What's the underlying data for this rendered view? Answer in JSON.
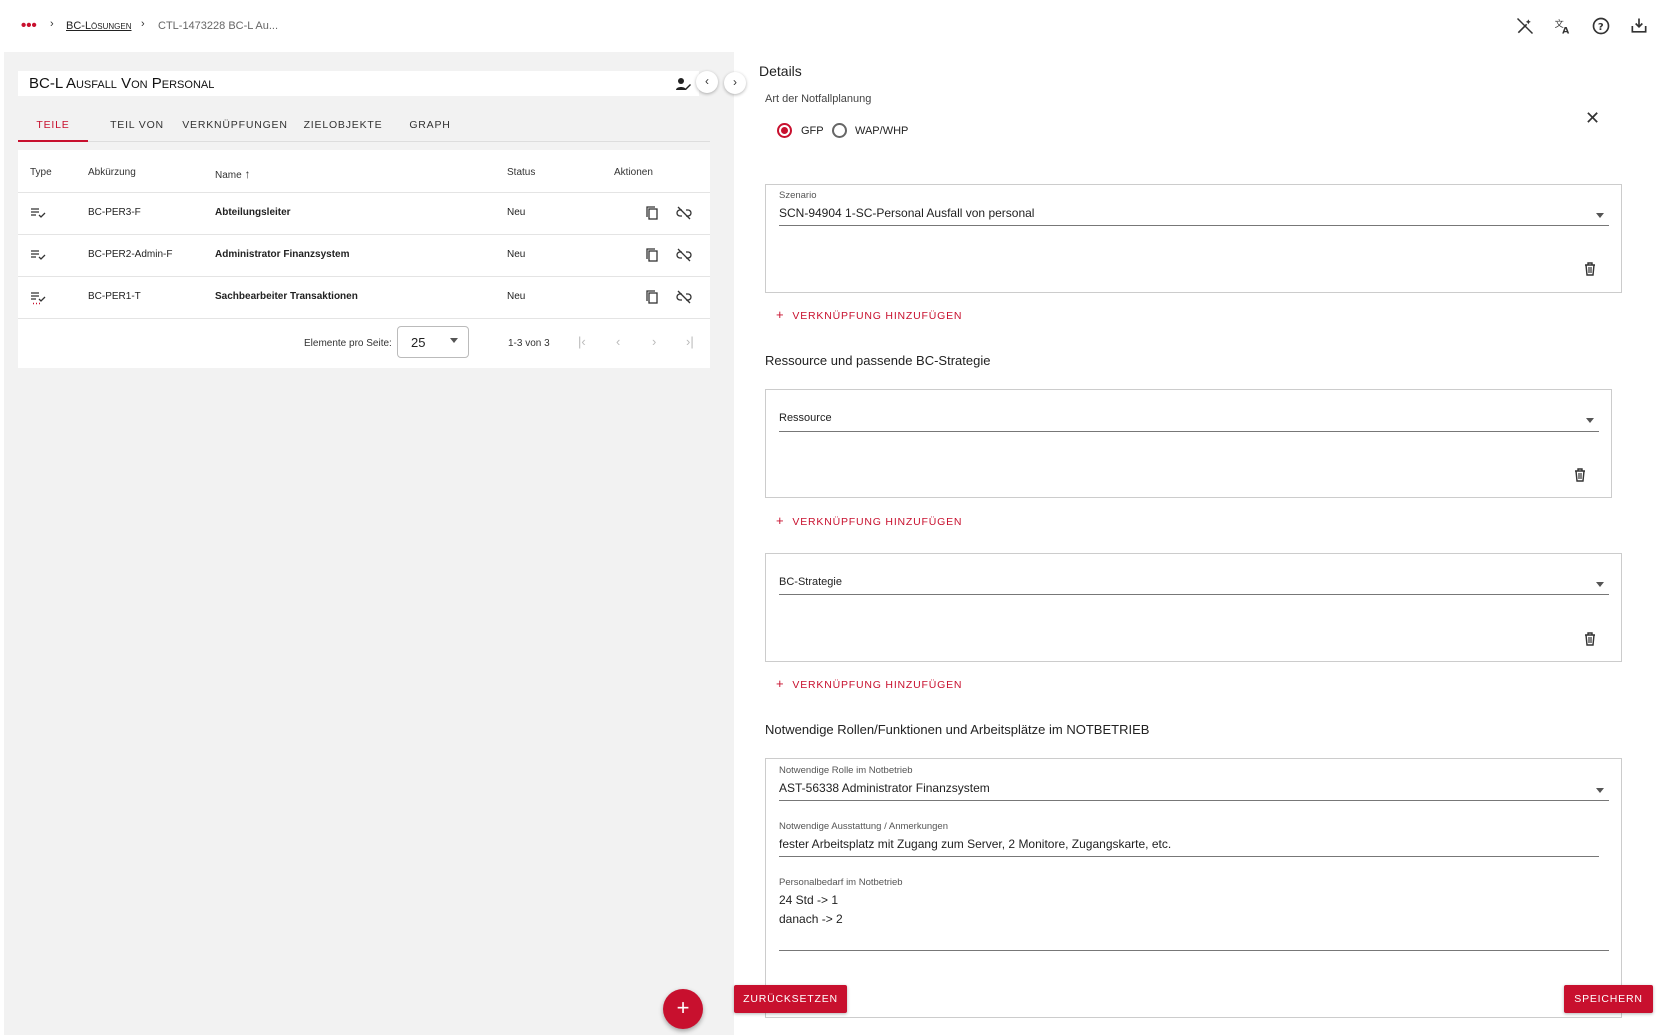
{
  "breadcrumb": {
    "menu_dots": "•••",
    "link": "BC-Lösungen",
    "current": "CTL-1473228 BC-L Au..."
  },
  "topbar_icons": [
    "magic-wand-off-icon",
    "translate-icon",
    "help-icon",
    "inbox-download-icon"
  ],
  "left": {
    "title": "BC-L Ausfall Von Personal",
    "tabs": [
      "TEILE",
      "TEIL VON",
      "VERKNÜPFUNGEN",
      "ZIELOBJEKTE",
      "GRAPH"
    ],
    "table": {
      "headers": {
        "type": "Type",
        "abk": "Abkürzung",
        "name": "Name",
        "status": "Status",
        "actions": "Aktionen"
      },
      "rows": [
        {
          "abk": "BC-PER3-F",
          "name": "Abteilungsleiter",
          "status": "Neu"
        },
        {
          "abk": "BC-PER2-Admin-F",
          "name": "Administrator Finanzsystem",
          "status": "Neu"
        },
        {
          "abk": "BC-PER1-T",
          "name": "Sachbearbeiter Transaktionen",
          "status": "Neu"
        }
      ]
    },
    "pager": {
      "label": "Elemente pro Seite:",
      "per_page": "25",
      "range": "1-3 von 3"
    },
    "fab": "+"
  },
  "right": {
    "details_title": "Details",
    "art_label": "Art der Notfallplanung",
    "radio_gfp": "GFP",
    "radio_wap": "WAP/WHP",
    "selected_radio": "GFP",
    "szenario": {
      "label": "Szenario",
      "value": "SCN-94904 1-SC-Personal Ausfall von personal"
    },
    "add_link": "VERKNÜPFUNG HINZUFÜGEN",
    "ressource_heading": "Ressource und passende BC-Strategie",
    "ressource_label": "Ressource",
    "strategie_label": "BC-Strategie",
    "rollen_heading": "Notwendige Rollen/Funktionen und Arbeitsplätze im NOTBETRIEB",
    "rolle": {
      "label": "Notwendige Rolle im Notbetrieb",
      "value": "AST-56338 Administrator Finanzsystem"
    },
    "ausstattung": {
      "label": "Notwendige Ausstattung / Anmerkungen",
      "value": "fester Arbeitsplatz mit Zugang zum Server, 2 Monitore, Zugangskarte, etc."
    },
    "personal": {
      "label": "Personalbedarf im Notbetrieb",
      "line1": "24 Std -> 1",
      "line2": "danach -> 2"
    },
    "reset_button": "ZURÜCKSETZEN",
    "save_button": "SPEICHERN"
  },
  "colors": {
    "accent": "#c8102e",
    "panel_bg": "#f2f2f2"
  }
}
